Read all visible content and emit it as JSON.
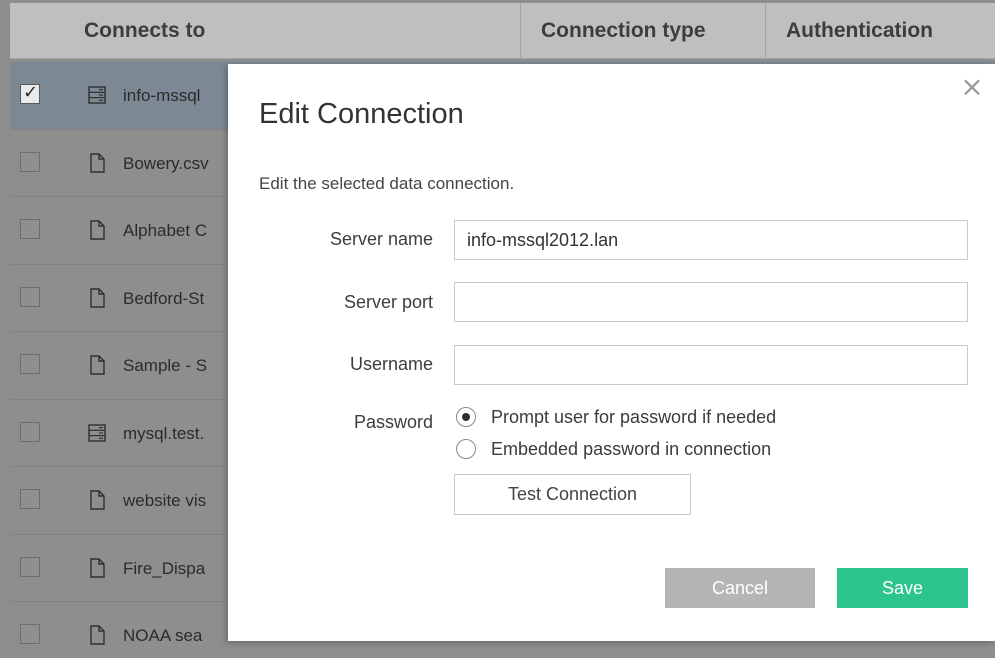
{
  "table": {
    "columns": {
      "connects_to": "Connects to",
      "connection_type": "Connection type",
      "authentication": "Authentication"
    },
    "rows": [
      {
        "label": "info-mssql",
        "icon": "database-icon",
        "selected": true
      },
      {
        "label": "Bowery.csv",
        "icon": "file-icon",
        "selected": false
      },
      {
        "label": "Alphabet C",
        "icon": "file-icon",
        "selected": false
      },
      {
        "label": "Bedford-St",
        "icon": "file-icon",
        "selected": false
      },
      {
        "label": "Sample - S",
        "icon": "file-icon",
        "selected": false
      },
      {
        "label": "mysql.test.",
        "icon": "database-icon",
        "selected": false
      },
      {
        "label": "website vis",
        "icon": "file-icon",
        "selected": false
      },
      {
        "label": "Fire_Dispa",
        "icon": "file-icon",
        "selected": false
      },
      {
        "label": "NOAA sea",
        "icon": "file-icon",
        "selected": false
      }
    ]
  },
  "dialog": {
    "title": "Edit Connection",
    "description": "Edit the selected data connection.",
    "close_glyph": "×",
    "server_name": {
      "label": "Server name",
      "value": "info-mssql2012.lan"
    },
    "server_port": {
      "label": "Server port",
      "value": ""
    },
    "username": {
      "label": "Username",
      "value": ""
    },
    "password": {
      "label": "Password",
      "options": [
        {
          "label": "Prompt user for password if needed",
          "selected": true
        },
        {
          "label": "Embedded password in connection",
          "selected": false
        }
      ]
    },
    "test_button": "Test Connection",
    "cancel_button": "Cancel",
    "save_button": "Save"
  },
  "colors": {
    "overlay": "#8e8e8e",
    "save": "#2dc58e",
    "cancel": "#b5b5b5"
  }
}
